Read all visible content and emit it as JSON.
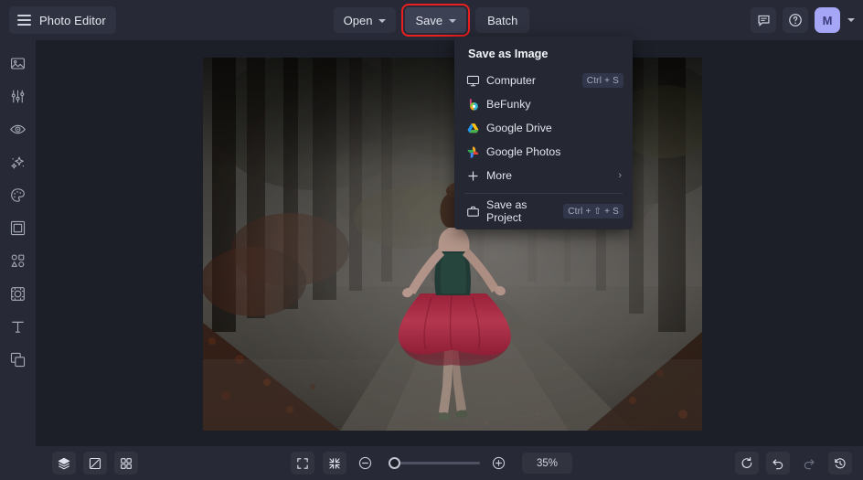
{
  "app": {
    "title": "Photo Editor",
    "menu_icon": "hamburger-icon",
    "accent_highlight": "#ea1f1f",
    "avatar_color": "#a6a6f7"
  },
  "toolbar": {
    "open_label": "Open",
    "save_label": "Save",
    "batch_label": "Batch",
    "feedback_icon": "chat-icon",
    "help_icon": "question-circle-icon",
    "avatar_initial": "M",
    "account_caret_icon": "chevron-down-icon"
  },
  "save_menu": {
    "title": "Save as Image",
    "items": [
      {
        "label": "Computer",
        "icon": "monitor-icon",
        "shortcut": "Ctrl + S"
      },
      {
        "label": "BeFunky",
        "icon": "befunky-logo-icon",
        "shortcut": ""
      },
      {
        "label": "Google Drive",
        "icon": "google-drive-icon",
        "shortcut": ""
      },
      {
        "label": "Google Photos",
        "icon": "google-photos-icon",
        "shortcut": ""
      },
      {
        "label": "More",
        "icon": "plus-icon",
        "shortcut": "",
        "arrow": "›"
      }
    ],
    "project": {
      "label": "Save as Project",
      "icon": "briefcase-icon",
      "shortcut": "Ctrl + ⇧ + S"
    }
  },
  "sidebar": {
    "items": [
      {
        "name": "image",
        "icon": "image-icon"
      },
      {
        "name": "edit",
        "icon": "sliders-icon"
      },
      {
        "name": "retouch",
        "icon": "eye-icon"
      },
      {
        "name": "effects",
        "icon": "sparkle-icon"
      },
      {
        "name": "artsy",
        "icon": "palette-icon"
      },
      {
        "name": "frames",
        "icon": "frame-icon"
      },
      {
        "name": "graphics",
        "icon": "shapes-icon"
      },
      {
        "name": "overlays",
        "icon": "overlay-icon"
      },
      {
        "name": "text",
        "icon": "text-t-icon"
      },
      {
        "name": "layers",
        "icon": "layers-icon"
      }
    ]
  },
  "canvas": {
    "image_alt": "woman in red dress walking on misty forest path"
  },
  "bottombar": {
    "left": [
      {
        "name": "layers-panel",
        "icon": "layers-stack-icon"
      },
      {
        "name": "resize-canvas",
        "icon": "crop-diagonal-icon"
      },
      {
        "name": "grid-view",
        "icon": "grid-icon"
      }
    ],
    "fullscreen_icon": "expand-icon",
    "fit_screen_icon": "collapse-icon",
    "zoom_out_icon": "minus-circle-icon",
    "zoom_in_icon": "plus-circle-icon",
    "zoom_value": "35%",
    "slider_position_pct": 6,
    "right": [
      {
        "name": "reset",
        "icon": "refresh-icon",
        "disabled": false
      },
      {
        "name": "undo",
        "icon": "undo-icon",
        "disabled": false
      },
      {
        "name": "redo",
        "icon": "redo-icon",
        "disabled": true
      },
      {
        "name": "history",
        "icon": "history-icon",
        "disabled": false
      }
    ]
  }
}
